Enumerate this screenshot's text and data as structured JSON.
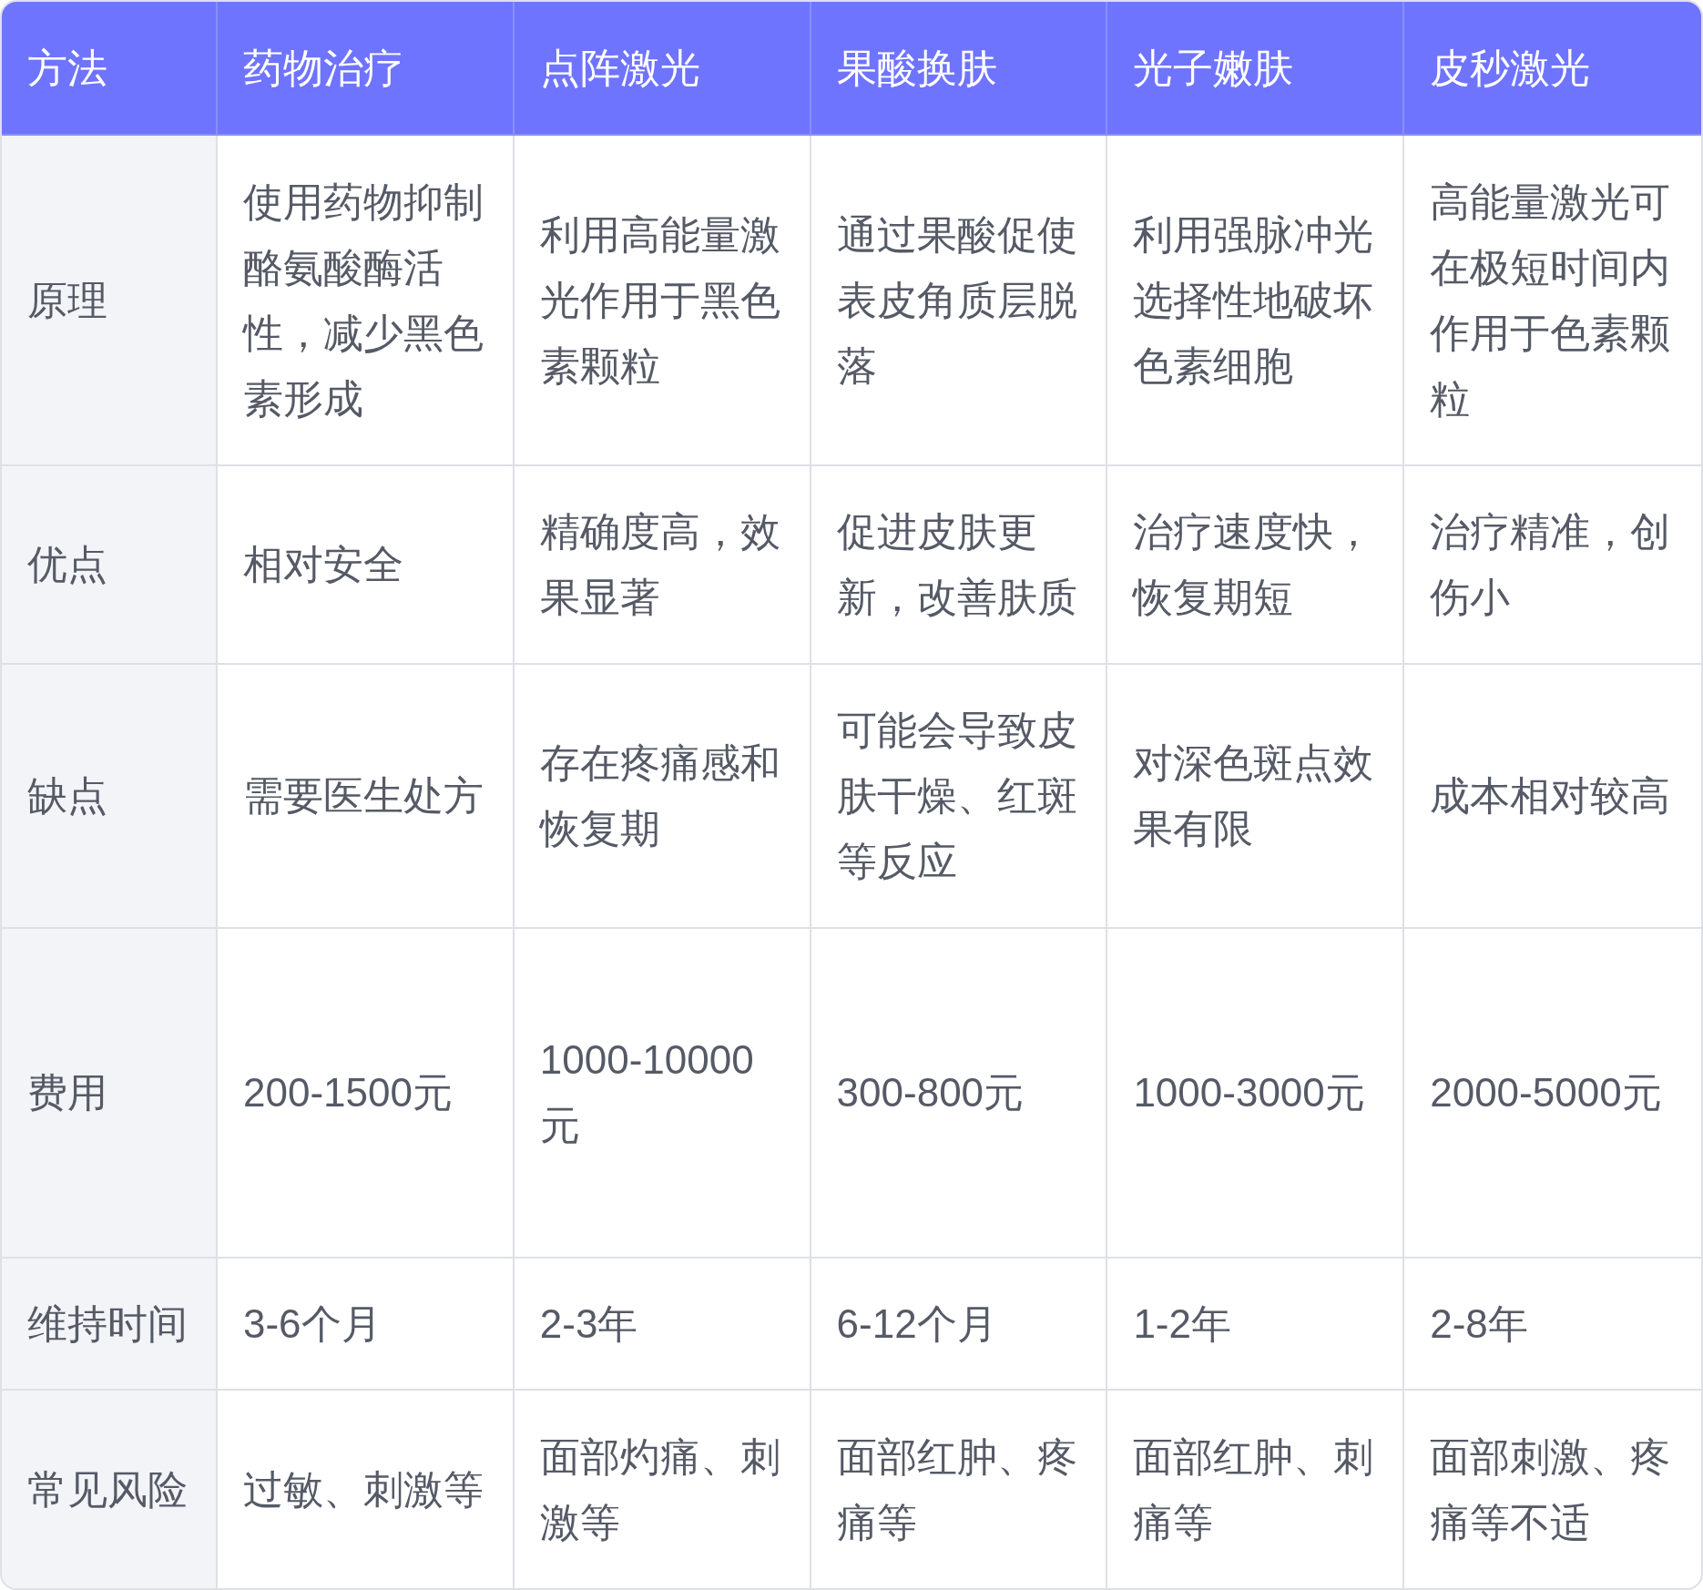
{
  "table": {
    "columns": [
      "方法",
      "药物治疗",
      "点阵激光",
      "果酸换肤",
      "光子嫩肤",
      "皮秒激光"
    ],
    "rows": [
      {
        "cells": [
          "原理",
          "使用药物抑制酪氨酸酶活性，减少黑色素形成",
          "利用高能量激光作用于黑色素颗粒",
          "通过果酸促使表皮角质层脱落",
          "利用强脉冲光选择性地破坏色素细胞",
          "高能量激光可在极短时间内作用于色素颗粒"
        ]
      },
      {
        "cells": [
          "优点",
          "相对安全",
          "精确度高，效果显著",
          "促进皮肤更新，改善肤质",
          "治疗速度快，恢复期短",
          "治疗精准，创伤小"
        ]
      },
      {
        "cells": [
          "缺点",
          "需要医生处方",
          "存在疼痛感和恢复期",
          "可能会导致皮肤干燥、红斑等反应",
          "对深色斑点效果有限",
          "成本相对较高"
        ]
      },
      {
        "cells": [
          "费用",
          "200-1500元",
          "1000-10000元",
          "300-800元",
          "1000-3000元",
          "2000-5000元"
        ]
      },
      {
        "cells": [
          "维持时间",
          "3-6个月",
          "2-3年",
          "6-12个月",
          "1-2年",
          "2-8年"
        ]
      },
      {
        "cells": [
          "常见风险",
          "过敏、刺激等",
          "面部灼痛、刺激等",
          "面部红肿、疼痛等",
          "面部红肿、刺痛等",
          "面部刺激、疼痛等不适"
        ]
      }
    ]
  }
}
